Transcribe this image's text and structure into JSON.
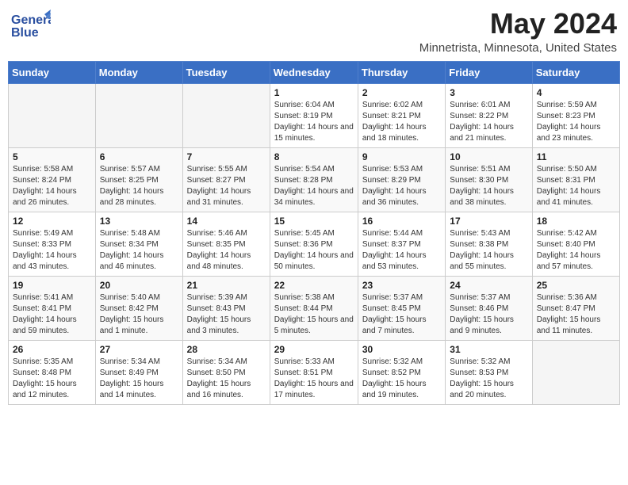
{
  "header": {
    "logo_general": "General",
    "logo_blue": "Blue",
    "month_title": "May 2024",
    "location": "Minnetrista, Minnesota, United States"
  },
  "days_of_week": [
    "Sunday",
    "Monday",
    "Tuesday",
    "Wednesday",
    "Thursday",
    "Friday",
    "Saturday"
  ],
  "weeks": [
    [
      {
        "day": "",
        "sunrise": "",
        "sunset": "",
        "daylight": "",
        "empty": true
      },
      {
        "day": "",
        "sunrise": "",
        "sunset": "",
        "daylight": "",
        "empty": true
      },
      {
        "day": "",
        "sunrise": "",
        "sunset": "",
        "daylight": "",
        "empty": true
      },
      {
        "day": "1",
        "sunrise": "Sunrise: 6:04 AM",
        "sunset": "Sunset: 8:19 PM",
        "daylight": "Daylight: 14 hours and 15 minutes.",
        "empty": false
      },
      {
        "day": "2",
        "sunrise": "Sunrise: 6:02 AM",
        "sunset": "Sunset: 8:21 PM",
        "daylight": "Daylight: 14 hours and 18 minutes.",
        "empty": false
      },
      {
        "day": "3",
        "sunrise": "Sunrise: 6:01 AM",
        "sunset": "Sunset: 8:22 PM",
        "daylight": "Daylight: 14 hours and 21 minutes.",
        "empty": false
      },
      {
        "day": "4",
        "sunrise": "Sunrise: 5:59 AM",
        "sunset": "Sunset: 8:23 PM",
        "daylight": "Daylight: 14 hours and 23 minutes.",
        "empty": false
      }
    ],
    [
      {
        "day": "5",
        "sunrise": "Sunrise: 5:58 AM",
        "sunset": "Sunset: 8:24 PM",
        "daylight": "Daylight: 14 hours and 26 minutes.",
        "empty": false
      },
      {
        "day": "6",
        "sunrise": "Sunrise: 5:57 AM",
        "sunset": "Sunset: 8:25 PM",
        "daylight": "Daylight: 14 hours and 28 minutes.",
        "empty": false
      },
      {
        "day": "7",
        "sunrise": "Sunrise: 5:55 AM",
        "sunset": "Sunset: 8:27 PM",
        "daylight": "Daylight: 14 hours and 31 minutes.",
        "empty": false
      },
      {
        "day": "8",
        "sunrise": "Sunrise: 5:54 AM",
        "sunset": "Sunset: 8:28 PM",
        "daylight": "Daylight: 14 hours and 34 minutes.",
        "empty": false
      },
      {
        "day": "9",
        "sunrise": "Sunrise: 5:53 AM",
        "sunset": "Sunset: 8:29 PM",
        "daylight": "Daylight: 14 hours and 36 minutes.",
        "empty": false
      },
      {
        "day": "10",
        "sunrise": "Sunrise: 5:51 AM",
        "sunset": "Sunset: 8:30 PM",
        "daylight": "Daylight: 14 hours and 38 minutes.",
        "empty": false
      },
      {
        "day": "11",
        "sunrise": "Sunrise: 5:50 AM",
        "sunset": "Sunset: 8:31 PM",
        "daylight": "Daylight: 14 hours and 41 minutes.",
        "empty": false
      }
    ],
    [
      {
        "day": "12",
        "sunrise": "Sunrise: 5:49 AM",
        "sunset": "Sunset: 8:33 PM",
        "daylight": "Daylight: 14 hours and 43 minutes.",
        "empty": false
      },
      {
        "day": "13",
        "sunrise": "Sunrise: 5:48 AM",
        "sunset": "Sunset: 8:34 PM",
        "daylight": "Daylight: 14 hours and 46 minutes.",
        "empty": false
      },
      {
        "day": "14",
        "sunrise": "Sunrise: 5:46 AM",
        "sunset": "Sunset: 8:35 PM",
        "daylight": "Daylight: 14 hours and 48 minutes.",
        "empty": false
      },
      {
        "day": "15",
        "sunrise": "Sunrise: 5:45 AM",
        "sunset": "Sunset: 8:36 PM",
        "daylight": "Daylight: 14 hours and 50 minutes.",
        "empty": false
      },
      {
        "day": "16",
        "sunrise": "Sunrise: 5:44 AM",
        "sunset": "Sunset: 8:37 PM",
        "daylight": "Daylight: 14 hours and 53 minutes.",
        "empty": false
      },
      {
        "day": "17",
        "sunrise": "Sunrise: 5:43 AM",
        "sunset": "Sunset: 8:38 PM",
        "daylight": "Daylight: 14 hours and 55 minutes.",
        "empty": false
      },
      {
        "day": "18",
        "sunrise": "Sunrise: 5:42 AM",
        "sunset": "Sunset: 8:40 PM",
        "daylight": "Daylight: 14 hours and 57 minutes.",
        "empty": false
      }
    ],
    [
      {
        "day": "19",
        "sunrise": "Sunrise: 5:41 AM",
        "sunset": "Sunset: 8:41 PM",
        "daylight": "Daylight: 14 hours and 59 minutes.",
        "empty": false
      },
      {
        "day": "20",
        "sunrise": "Sunrise: 5:40 AM",
        "sunset": "Sunset: 8:42 PM",
        "daylight": "Daylight: 15 hours and 1 minute.",
        "empty": false
      },
      {
        "day": "21",
        "sunrise": "Sunrise: 5:39 AM",
        "sunset": "Sunset: 8:43 PM",
        "daylight": "Daylight: 15 hours and 3 minutes.",
        "empty": false
      },
      {
        "day": "22",
        "sunrise": "Sunrise: 5:38 AM",
        "sunset": "Sunset: 8:44 PM",
        "daylight": "Daylight: 15 hours and 5 minutes.",
        "empty": false
      },
      {
        "day": "23",
        "sunrise": "Sunrise: 5:37 AM",
        "sunset": "Sunset: 8:45 PM",
        "daylight": "Daylight: 15 hours and 7 minutes.",
        "empty": false
      },
      {
        "day": "24",
        "sunrise": "Sunrise: 5:37 AM",
        "sunset": "Sunset: 8:46 PM",
        "daylight": "Daylight: 15 hours and 9 minutes.",
        "empty": false
      },
      {
        "day": "25",
        "sunrise": "Sunrise: 5:36 AM",
        "sunset": "Sunset: 8:47 PM",
        "daylight": "Daylight: 15 hours and 11 minutes.",
        "empty": false
      }
    ],
    [
      {
        "day": "26",
        "sunrise": "Sunrise: 5:35 AM",
        "sunset": "Sunset: 8:48 PM",
        "daylight": "Daylight: 15 hours and 12 minutes.",
        "empty": false
      },
      {
        "day": "27",
        "sunrise": "Sunrise: 5:34 AM",
        "sunset": "Sunset: 8:49 PM",
        "daylight": "Daylight: 15 hours and 14 minutes.",
        "empty": false
      },
      {
        "day": "28",
        "sunrise": "Sunrise: 5:34 AM",
        "sunset": "Sunset: 8:50 PM",
        "daylight": "Daylight: 15 hours and 16 minutes.",
        "empty": false
      },
      {
        "day": "29",
        "sunrise": "Sunrise: 5:33 AM",
        "sunset": "Sunset: 8:51 PM",
        "daylight": "Daylight: 15 hours and 17 minutes.",
        "empty": false
      },
      {
        "day": "30",
        "sunrise": "Sunrise: 5:32 AM",
        "sunset": "Sunset: 8:52 PM",
        "daylight": "Daylight: 15 hours and 19 minutes.",
        "empty": false
      },
      {
        "day": "31",
        "sunrise": "Sunrise: 5:32 AM",
        "sunset": "Sunset: 8:53 PM",
        "daylight": "Daylight: 15 hours and 20 minutes.",
        "empty": false
      },
      {
        "day": "",
        "sunrise": "",
        "sunset": "",
        "daylight": "",
        "empty": true
      }
    ]
  ]
}
